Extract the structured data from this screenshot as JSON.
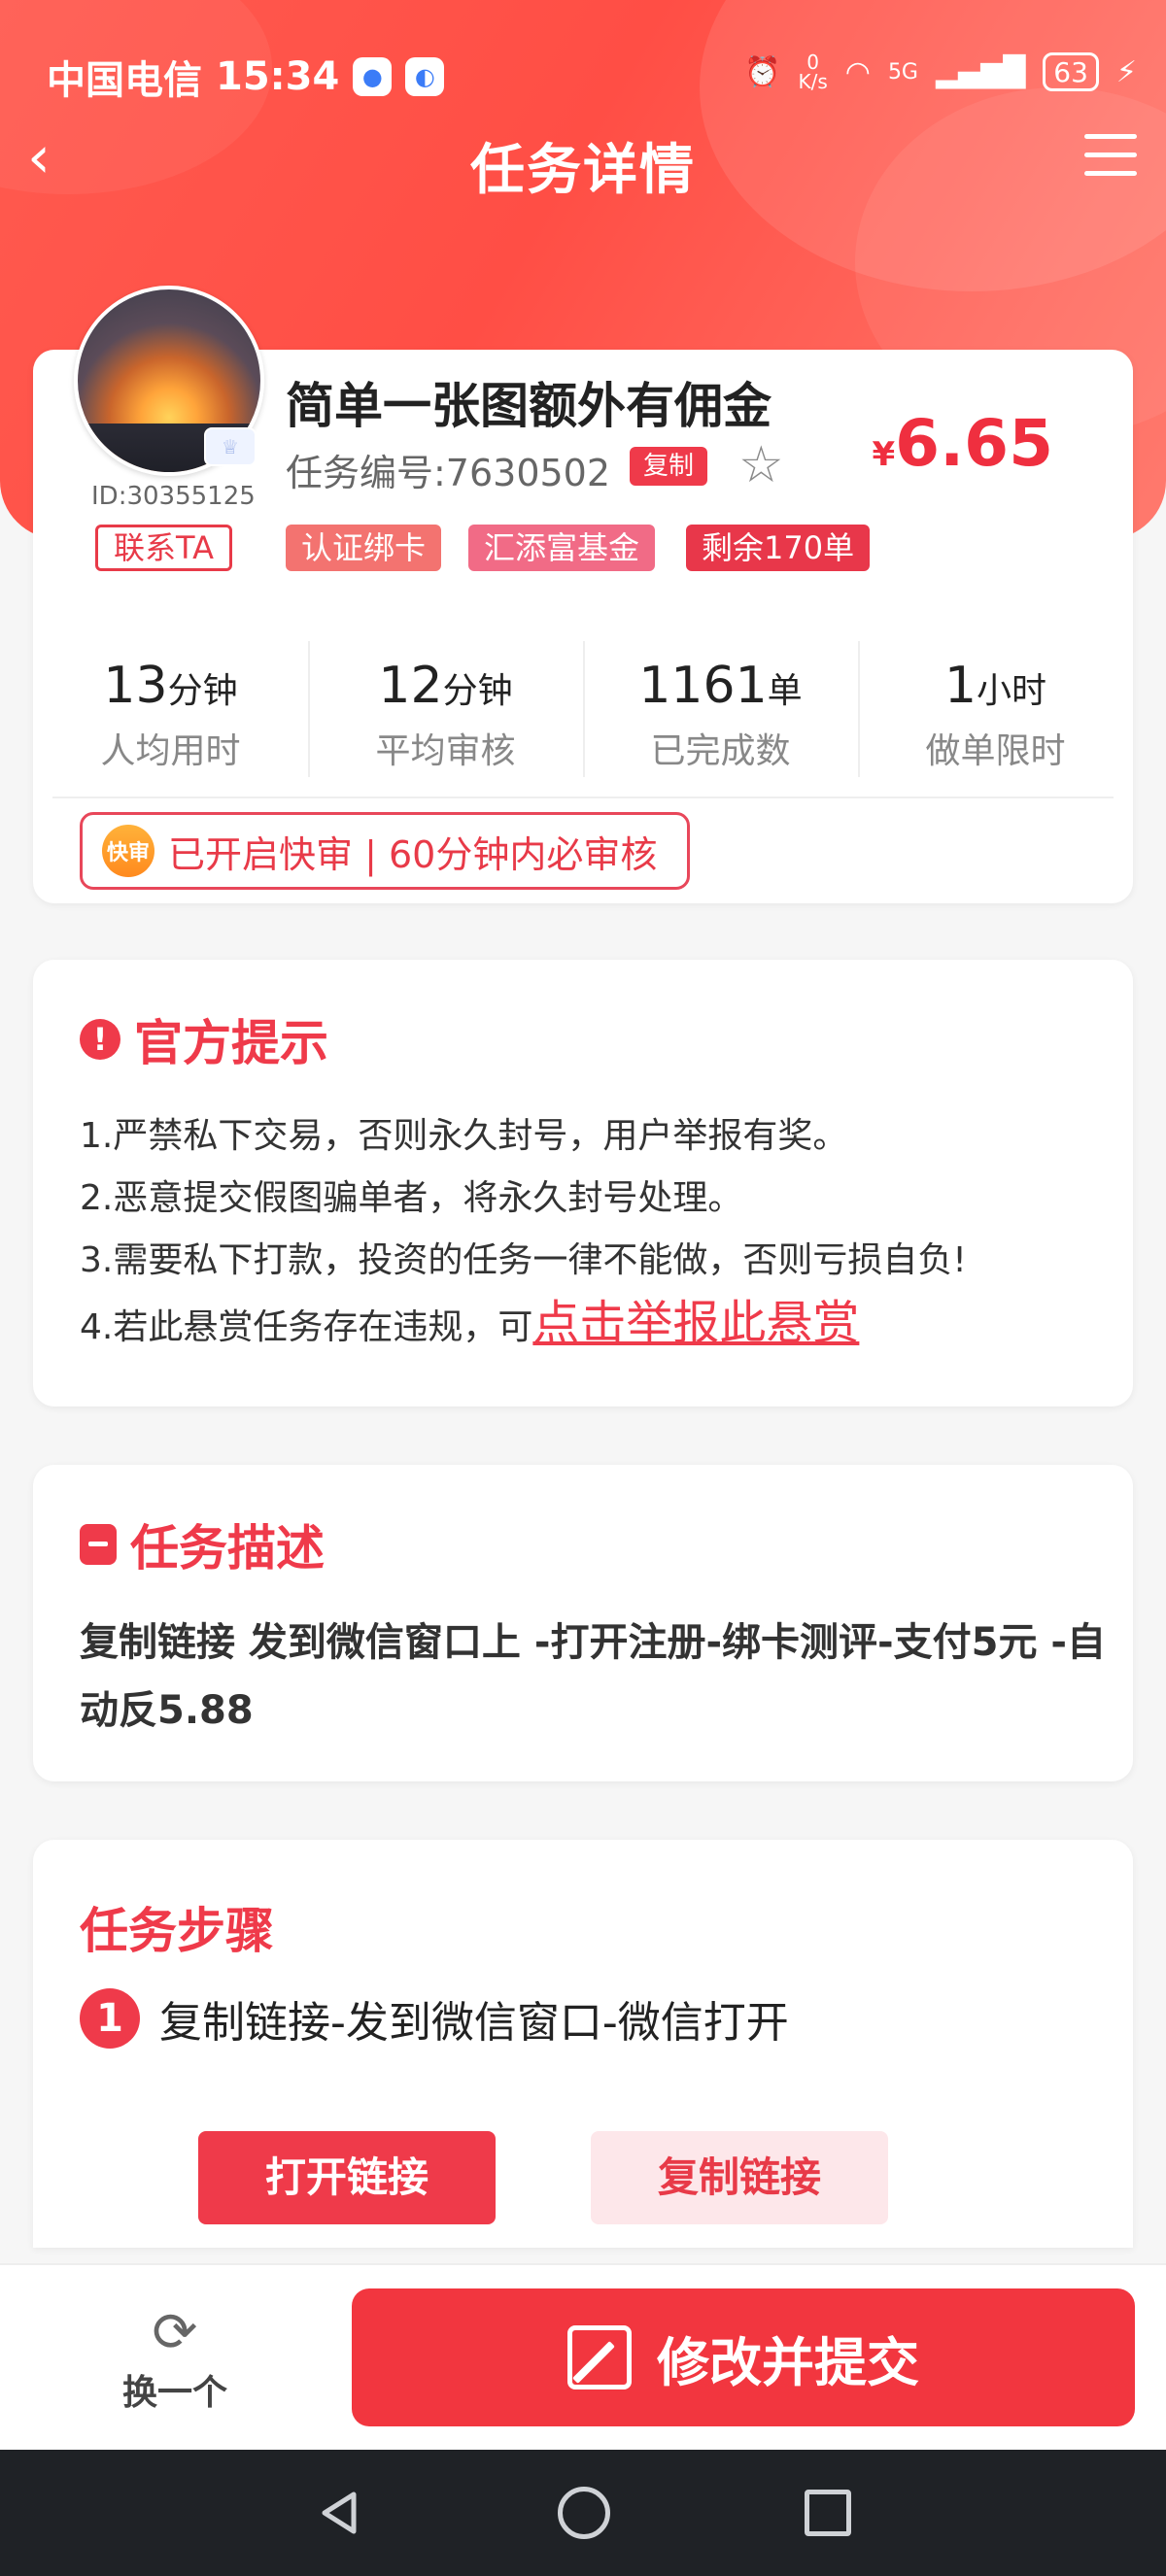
{
  "status_bar": {
    "carrier": "中国电信",
    "time": "15:34",
    "net_speed_value": "0",
    "net_speed_unit": "K/s",
    "network": "5G",
    "battery": "63"
  },
  "nav": {
    "title": "任务详情"
  },
  "task": {
    "title": "简单一张图额外有佣金",
    "number_label": "任务编号:7630502",
    "copy_label": "复制",
    "price_currency": "¥",
    "price": "6.65",
    "user_id": "ID:30355125",
    "contact_label": "联系TA",
    "tags": [
      "认证绑卡",
      "汇添富基金",
      "剩余170单"
    ],
    "stats": [
      {
        "value": "13",
        "unit": "分钟",
        "label": "人均用时"
      },
      {
        "value": "12",
        "unit": "分钟",
        "label": "平均审核"
      },
      {
        "value": "1161",
        "unit": "单",
        "label": "已完成数"
      },
      {
        "value": "1",
        "unit": "小时",
        "label": "做单限时"
      }
    ],
    "fast_review_badge": "快审",
    "fast_review_text": "已开启快审 | 60分钟内必审核"
  },
  "tips": {
    "title": "官方提示",
    "items": [
      "1.严禁私下交易，否则永久封号，用户举报有奖。",
      "2.恶意提交假图骗单者，将永久封号处理。",
      "3.需要私下打款，投资的任务一律不能做，否则亏损自负!",
      "4.若此悬赏任务存在违规，可"
    ],
    "report_link": "点击举报此悬赏"
  },
  "description": {
    "title": "任务描述",
    "text": "复制链接 发到微信窗口上 -打开注册-绑卡测评-支付5元 -自动反5.88"
  },
  "steps": {
    "title": "任务步骤",
    "items": [
      {
        "num": "1",
        "text": "复制链接-发到微信窗口-微信打开"
      }
    ],
    "open_link_label": "打开链接",
    "copy_link_label": "复制链接"
  },
  "bottom": {
    "switch_label": "换一个",
    "submit_label": "修改并提交"
  },
  "colors": {
    "accent": "#ef3a4a",
    "header": "#ff5a4f"
  }
}
